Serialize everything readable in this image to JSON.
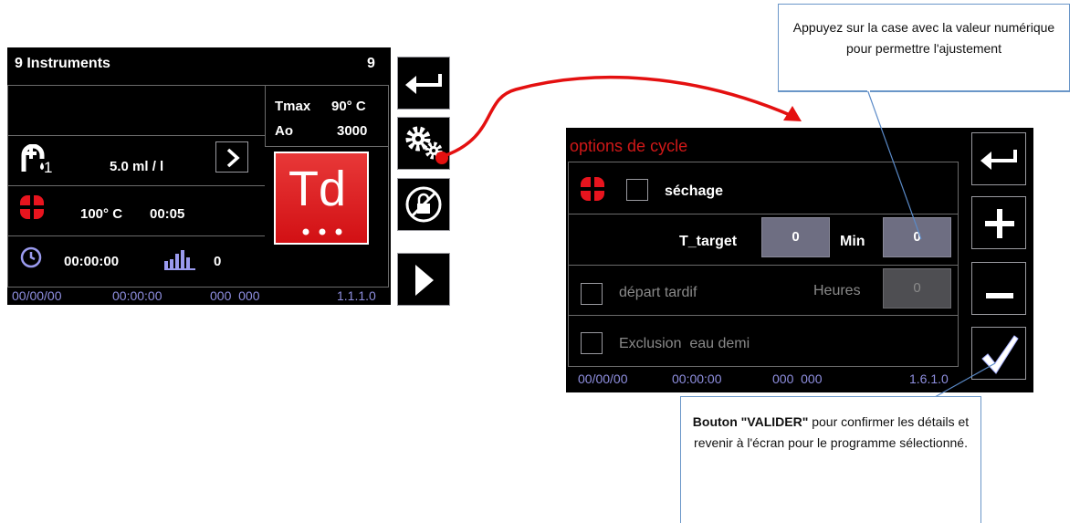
{
  "left_screen": {
    "title": "9 Instruments",
    "count": "9",
    "tmax_label": "Tmax",
    "tmax_value": "90° C",
    "ao_label": "Ao",
    "ao_value": "3000",
    "dose_sub": "1",
    "dose": "5.0 ml / l",
    "temp": "100° C",
    "time": "00:05",
    "clock": "00:00:00",
    "counter": "0",
    "program": "Td",
    "status": {
      "date": "00/00/00",
      "time": "00:00:00",
      "code": "000  000",
      "version": "1.1.1.0"
    }
  },
  "right_screen": {
    "title": "options de cycle",
    "drying_label": "séchage",
    "t_target_label": "T_target",
    "t_target_value": "0",
    "min_label": "Min",
    "min_value": "0",
    "late_start_label": "départ tardif",
    "hours_label": "Heures",
    "hours_value": "0",
    "exclusion_label": "Exclusion  eau demi",
    "status": {
      "date": "00/00/00",
      "time": "00:00:00",
      "code": "000  000",
      "version": "1.6.1.0"
    }
  },
  "callouts": {
    "top": "Appuyez sur la case avec la valeur numérique pour permettre l'ajustement",
    "bottom_bold": "Bouton \"VALIDER\"",
    "bottom_rest": " pour confirmer les détails et revenir à l'écran pour le programme sélectionné."
  },
  "colors": {
    "accent_red": "#e8141e",
    "title_red": "#d01818",
    "status_blue": "#8f8fe0",
    "callout_border": "#6a96c8"
  },
  "icons": [
    "back-arrow-icon",
    "gears-icon",
    "no-lock-icon",
    "play-icon",
    "plus-icon",
    "minus-icon",
    "checkmark-icon",
    "fan-icon",
    "dose-icon",
    "clock-icon",
    "bar-chart-icon",
    "chevron-right-icon"
  ]
}
